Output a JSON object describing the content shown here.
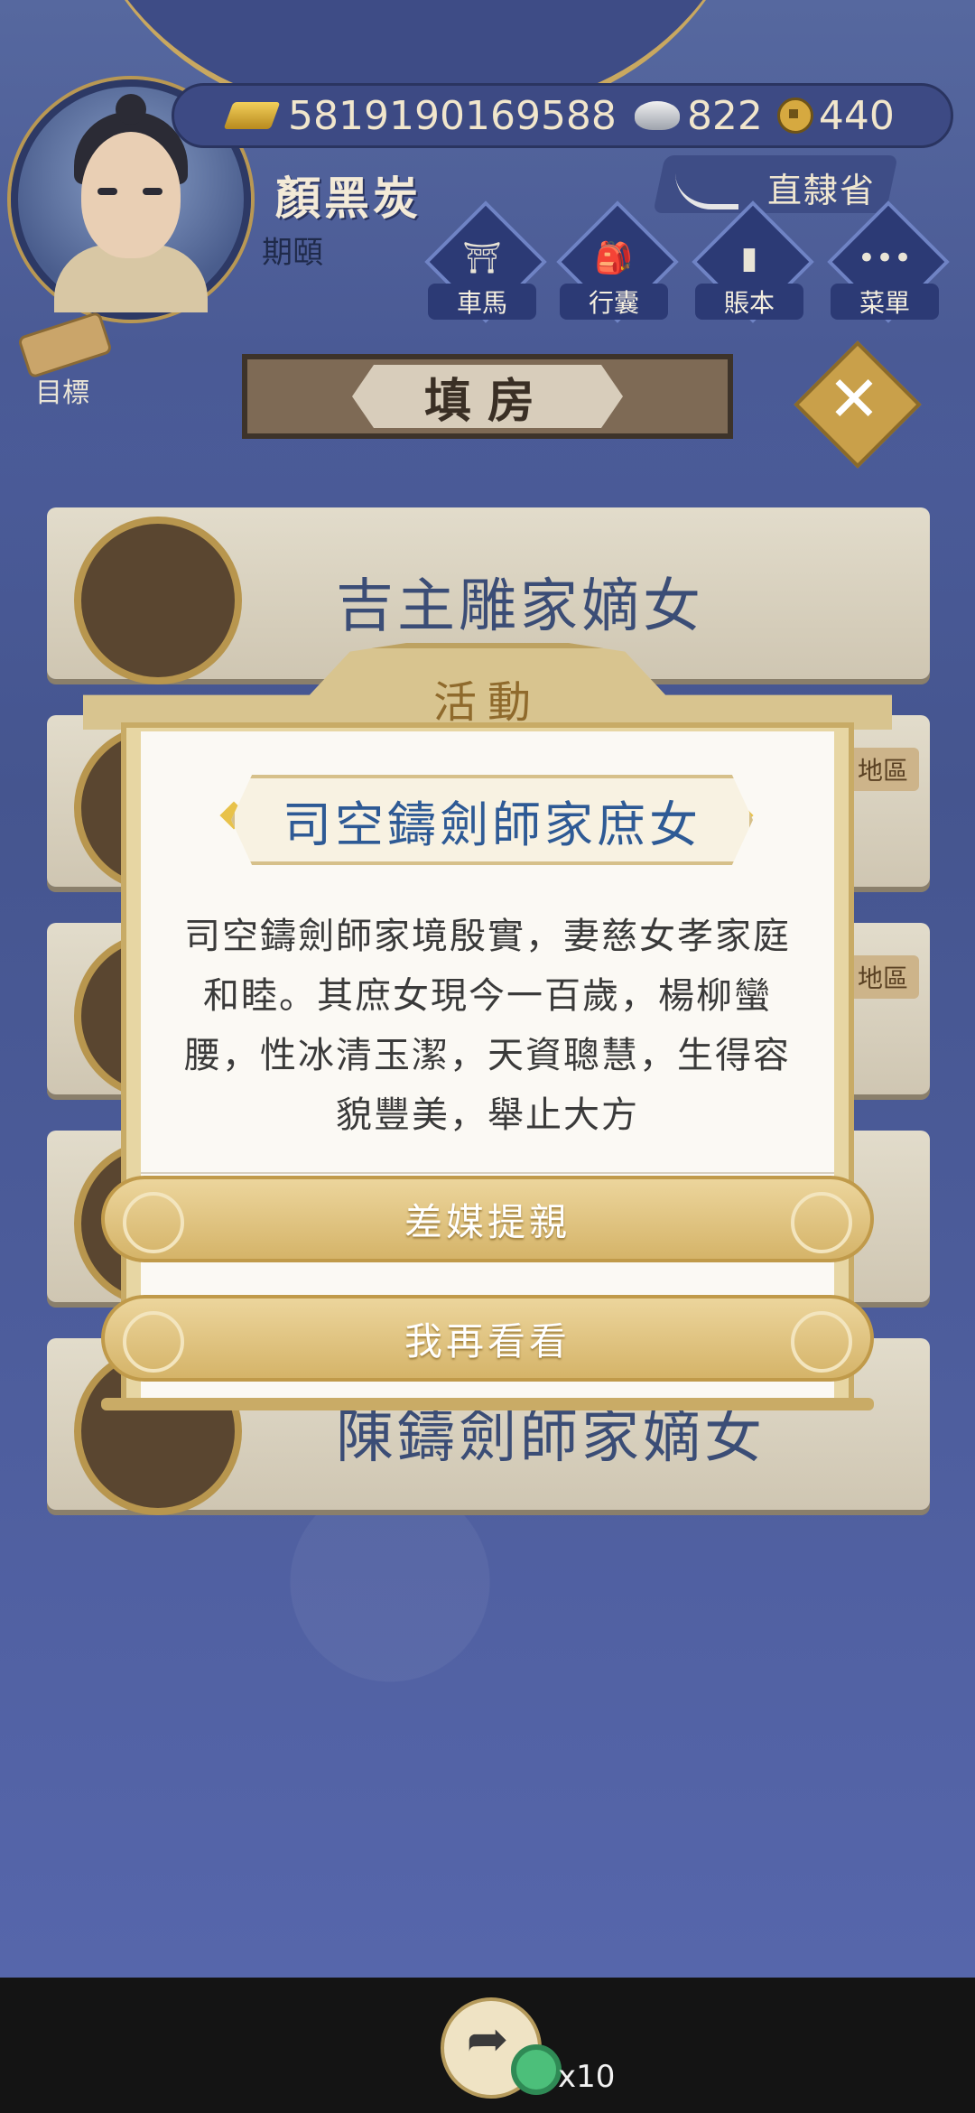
{
  "player": {
    "gold": "5819190169588",
    "silver": "822",
    "coins": "440",
    "name": "顏黑炭",
    "title": "期頤",
    "region": "直隸省"
  },
  "menu": [
    {
      "label": "車馬",
      "icon": "carriage-icon"
    },
    {
      "label": "行囊",
      "icon": "bag-icon"
    },
    {
      "label": "賬本",
      "icon": "ledger-icon"
    },
    {
      "label": "菜單",
      "icon": "more-icon"
    }
  ],
  "goal_label": "目標",
  "screen_title": "填房",
  "cards": [
    {
      "name": "吉主雕家嫡女",
      "tag": ""
    },
    {
      "name": "",
      "tag": "地區"
    },
    {
      "name": "",
      "tag": "地區"
    },
    {
      "name": "",
      "tag": ""
    },
    {
      "name": "陳鑄劍師家嫡女",
      "tag": ""
    }
  ],
  "modal": {
    "header": "活動",
    "candidate": "司空鑄劍師家庶女",
    "description": "司空鑄劍師家境殷實，妻慈女孝家庭和睦。其庶女現今一百歲，楊柳蠻腰，性冰清玉潔，天資聰慧，生得容貌豐美，舉止大方",
    "primary_button": "差媒提親",
    "secondary_button": "我再看看"
  },
  "bottom": {
    "count": "x10"
  }
}
